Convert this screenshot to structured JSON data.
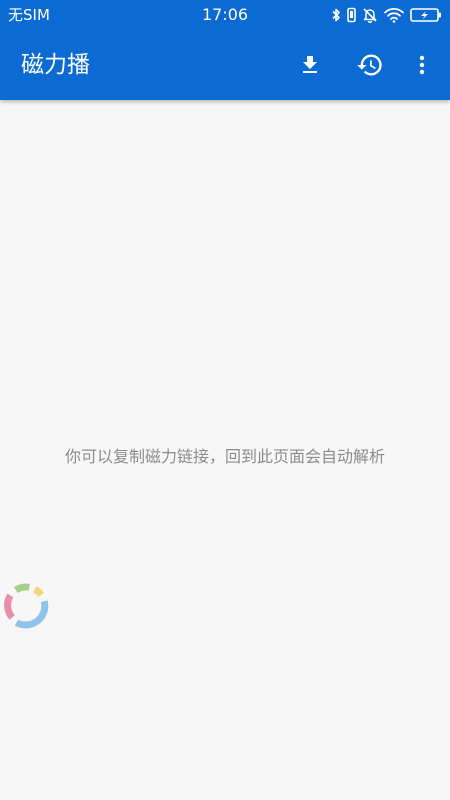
{
  "status_bar": {
    "carrier": "无SIM",
    "time": "17:06",
    "icons": [
      "bluetooth-icon",
      "vibrate-icon",
      "mute-bell-icon",
      "wifi-icon",
      "battery-icon"
    ]
  },
  "app_bar": {
    "title": "磁力播",
    "actions": [
      "download-icon",
      "history-icon",
      "more-vert-icon"
    ]
  },
  "content": {
    "hint": "你可以复制磁力链接，回到此页面会自动解析"
  },
  "colors": {
    "primary": "#0b6bd3",
    "background": "#f7f7f7",
    "hint_text": "#8c8c8c",
    "ring_pink": "#e58fa8",
    "ring_green": "#a7cf8e",
    "ring_yellow": "#f3d57a",
    "ring_blue": "#8fc3ea"
  }
}
